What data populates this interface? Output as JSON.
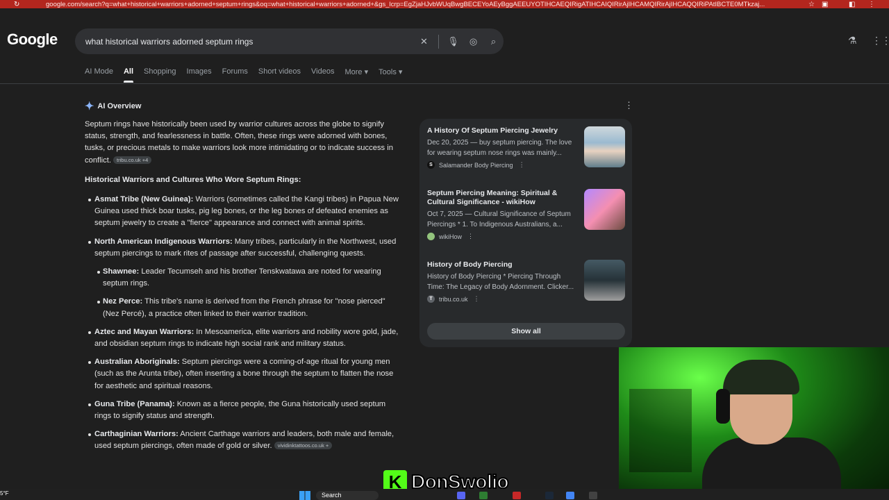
{
  "browser": {
    "url": "google.com/search?q=what+historical+warriors+adorned+septum+rings&oq=what+historical+warriors+adorned+&gs_lcrp=EgZjaHJvbWUqBwgBECEYoAEyBggAEEUYOTIHCAEQIRigATIHCAIQIRirAjIHCAMQIRirAjIHCAQQIRiPAtIBCTE0MTkzaj..."
  },
  "google": {
    "logo": "Google",
    "query": "what historical warriors adorned septum rings"
  },
  "tabs": [
    "AI Mode",
    "All",
    "Shopping",
    "Images",
    "Forums",
    "Short videos",
    "Videos",
    "More",
    "Tools"
  ],
  "ai_overview": {
    "label": "AI Overview",
    "intro": "Septum rings have historically been used by warrior cultures across the globe to signify status, strength, and fearlessness in battle. Often, these rings were adorned with bones, tusks, or precious metals to make warriors look more intimidating or to indicate success in conflict.",
    "intro_chip": "tribu.co.uk +4",
    "heading": "Historical Warriors and Cultures Who Wore Septum Rings:",
    "items": [
      {
        "title": "Asmat Tribe (New Guinea):",
        "text": " Warriors (sometimes called the Kangi tribes) in Papua New Guinea used thick boar tusks, pig leg bones, or the leg bones of defeated enemies as septum jewelry to create a \"fierce\" appearance and connect with animal spirits."
      },
      {
        "title": "North American Indigenous Warriors:",
        "text": " Many tribes, particularly in the Northwest, used septum piercings to mark rites of passage after successful, challenging quests."
      },
      {
        "title": "Aztec and Mayan Warriors:",
        "text": " In Mesoamerica, elite warriors and nobility wore gold, jade, and obsidian septum rings to indicate high social rank and military status."
      },
      {
        "title": "Australian Aboriginals:",
        "text": " Septum piercings were a coming-of-age ritual for young men (such as the Arunta tribe), often inserting a bone through the septum to flatten the nose for aesthetic and spiritual reasons."
      },
      {
        "title": "Guna Tribe (Panama):",
        "text": " Known as a fierce people, the Guna historically used septum rings to signify status and strength."
      },
      {
        "title": "Carthaginian Warriors:",
        "text": " Ancient Carthage warriors and leaders, both male and female, used septum piercings, often made of gold or silver."
      }
    ],
    "subitems": [
      {
        "title": "Shawnee:",
        "text": " Leader Tecumseh and his brother Tenskwatawa are noted for wearing septum rings."
      },
      {
        "title": "Nez Perce:",
        "text": " This tribe's name is derived from the French phrase for \"nose pierced\" (Nez Percé), a practice often linked to their warrior tradition."
      }
    ],
    "last_chip": "vividinktattoos.co.uk +"
  },
  "sources": [
    {
      "title": "A History Of Septum Piercing Jewelry",
      "snippet": "Dec 20, 2025 — buy septum piercing. The love for wearing septum nose rings was mainly...",
      "site": "Salamander Body Piercing",
      "fav": "S"
    },
    {
      "title": "Septum Piercing Meaning: Spiritual & Cultural Significance - wikiHow",
      "snippet": "Oct 7, 2025 — Cultural Significance of Septum Piercings * 1. To Indigenous Australians, a...",
      "site": "wikiHow",
      "fav": ""
    },
    {
      "title": "History of Body Piercing",
      "snippet": "History of Body Piercing * Piercing Through Time: The Legacy of Body Adornment. Clicker...",
      "site": "tribu.co.uk",
      "fav": "T"
    }
  ],
  "show_all": "Show all",
  "overlay": {
    "streamer": "DonSwolio",
    "k": "K"
  },
  "taskbar": {
    "search": "Search",
    "temp": "5°F"
  }
}
